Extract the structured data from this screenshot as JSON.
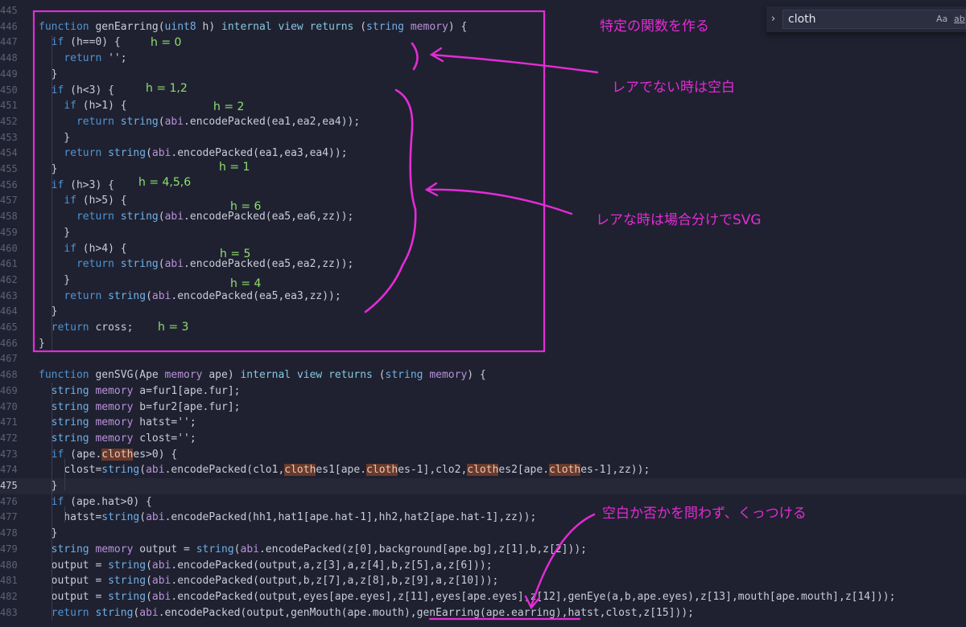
{
  "editor": {
    "lines": [
      {
        "n": "445",
        "code": []
      },
      {
        "n": "446",
        "code": [
          [
            "kw",
            "function"
          ],
          [
            "",
            ""
          ],
          [
            "",
            " genEarring("
          ],
          [
            "ty",
            "uint8"
          ],
          [
            "",
            " h) "
          ],
          [
            "mod",
            "internal"
          ],
          [
            "",
            " "
          ],
          [
            "mod",
            "view"
          ],
          [
            "",
            " "
          ],
          [
            "mod",
            "returns"
          ],
          [
            "",
            " ("
          ],
          [
            "ty",
            "string"
          ],
          [
            "",
            " "
          ],
          [
            "mem",
            "memory"
          ],
          [
            "",
            ") {"
          ]
        ]
      },
      {
        "n": "447",
        "code": [
          [
            "",
            "  "
          ],
          [
            "kw",
            "if"
          ],
          [
            "",
            " (h==0) {"
          ]
        ]
      },
      {
        "n": "448",
        "code": [
          [
            "",
            "    "
          ],
          [
            "kw",
            "return"
          ],
          [
            "",
            " '';"
          ]
        ]
      },
      {
        "n": "449",
        "code": [
          [
            "",
            "  }"
          ]
        ]
      },
      {
        "n": "450",
        "code": [
          [
            "",
            "  "
          ],
          [
            "kw",
            "if"
          ],
          [
            "",
            " (h<3) {"
          ]
        ]
      },
      {
        "n": "451",
        "code": [
          [
            "",
            "    "
          ],
          [
            "kw",
            "if"
          ],
          [
            "",
            " (h>1) {"
          ]
        ]
      },
      {
        "n": "452",
        "code": [
          [
            "",
            "      "
          ],
          [
            "kw",
            "return"
          ],
          [
            "",
            " "
          ],
          [
            "ty",
            "string"
          ],
          [
            "",
            "("
          ],
          [
            "mem",
            "abi"
          ],
          [
            "",
            ".encodePacked(ea1,ea2,ea4));"
          ]
        ]
      },
      {
        "n": "453",
        "code": [
          [
            "",
            "    }"
          ]
        ]
      },
      {
        "n": "454",
        "code": [
          [
            "",
            "    "
          ],
          [
            "kw",
            "return"
          ],
          [
            "",
            " "
          ],
          [
            "ty",
            "string"
          ],
          [
            "",
            "("
          ],
          [
            "mem",
            "abi"
          ],
          [
            "",
            ".encodePacked(ea1,ea3,ea4));"
          ]
        ]
      },
      {
        "n": "455",
        "code": [
          [
            "",
            "  }"
          ]
        ]
      },
      {
        "n": "456",
        "code": [
          [
            "",
            "  "
          ],
          [
            "kw",
            "if"
          ],
          [
            "",
            " (h>3) {"
          ]
        ]
      },
      {
        "n": "457",
        "code": [
          [
            "",
            "    "
          ],
          [
            "kw",
            "if"
          ],
          [
            "",
            " (h>5) {"
          ]
        ]
      },
      {
        "n": "458",
        "code": [
          [
            "",
            "      "
          ],
          [
            "kw",
            "return"
          ],
          [
            "",
            " "
          ],
          [
            "ty",
            "string"
          ],
          [
            "",
            "("
          ],
          [
            "mem",
            "abi"
          ],
          [
            "",
            ".encodePacked(ea5,ea6,zz));"
          ]
        ]
      },
      {
        "n": "459",
        "code": [
          [
            "",
            "    }"
          ]
        ]
      },
      {
        "n": "460",
        "code": [
          [
            "",
            "    "
          ],
          [
            "kw",
            "if"
          ],
          [
            "",
            " (h>4) {"
          ]
        ]
      },
      {
        "n": "461",
        "code": [
          [
            "",
            "      "
          ],
          [
            "kw",
            "return"
          ],
          [
            "",
            " "
          ],
          [
            "ty",
            "string"
          ],
          [
            "",
            "("
          ],
          [
            "mem",
            "abi"
          ],
          [
            "",
            ".encodePacked(ea5,ea2,zz));"
          ]
        ]
      },
      {
        "n": "462",
        "code": [
          [
            "",
            "    }"
          ]
        ]
      },
      {
        "n": "463",
        "code": [
          [
            "",
            "    "
          ],
          [
            "kw",
            "return"
          ],
          [
            "",
            " "
          ],
          [
            "ty",
            "string"
          ],
          [
            "",
            "("
          ],
          [
            "mem",
            "abi"
          ],
          [
            "",
            ".encodePacked(ea5,ea3,zz));"
          ]
        ]
      },
      {
        "n": "464",
        "code": [
          [
            "",
            "  }"
          ]
        ]
      },
      {
        "n": "465",
        "code": [
          [
            "",
            "  "
          ],
          [
            "kw",
            "return"
          ],
          [
            "",
            " cross;"
          ]
        ]
      },
      {
        "n": "466",
        "code": [
          [
            "",
            "}"
          ]
        ]
      },
      {
        "n": "467",
        "code": []
      },
      {
        "n": "468",
        "code": [
          [
            "kw",
            "function"
          ],
          [
            "",
            " genSVG(Ape "
          ],
          [
            "mem",
            "memory"
          ],
          [
            "",
            " ape) "
          ],
          [
            "mod",
            "internal"
          ],
          [
            "",
            " "
          ],
          [
            "mod",
            "view"
          ],
          [
            "",
            " "
          ],
          [
            "mod",
            "returns"
          ],
          [
            "",
            " ("
          ],
          [
            "ty",
            "string"
          ],
          [
            "",
            " "
          ],
          [
            "mem",
            "memory"
          ],
          [
            "",
            ") {"
          ]
        ]
      },
      {
        "n": "469",
        "code": [
          [
            "",
            "  "
          ],
          [
            "ty",
            "string"
          ],
          [
            "",
            " "
          ],
          [
            "mem",
            "memory"
          ],
          [
            "",
            " a=fur1[ape.fur];"
          ]
        ]
      },
      {
        "n": "470",
        "code": [
          [
            "",
            "  "
          ],
          [
            "ty",
            "string"
          ],
          [
            "",
            " "
          ],
          [
            "mem",
            "memory"
          ],
          [
            "",
            " b=fur2[ape.fur];"
          ]
        ]
      },
      {
        "n": "471",
        "code": [
          [
            "",
            "  "
          ],
          [
            "ty",
            "string"
          ],
          [
            "",
            " "
          ],
          [
            "mem",
            "memory"
          ],
          [
            "",
            " hatst='';"
          ]
        ]
      },
      {
        "n": "472",
        "code": [
          [
            "",
            "  "
          ],
          [
            "ty",
            "string"
          ],
          [
            "",
            " "
          ],
          [
            "mem",
            "memory"
          ],
          [
            "",
            " clost='';"
          ]
        ]
      },
      {
        "n": "473",
        "code": [
          [
            "",
            "  "
          ],
          [
            "kw",
            "if"
          ],
          [
            "",
            " (ape."
          ],
          [
            "hl",
            "cloth"
          ],
          [
            "",
            "es>0) {"
          ]
        ]
      },
      {
        "n": "474",
        "code": [
          [
            "",
            "    clost="
          ],
          [
            "ty",
            "string"
          ],
          [
            "",
            "("
          ],
          [
            "mem",
            "abi"
          ],
          [
            "",
            ".encodePacked(clo1,"
          ],
          [
            "hl",
            "cloth"
          ],
          [
            "",
            "es1[ape."
          ],
          [
            "hl",
            "cloth"
          ],
          [
            "",
            "es-1],clo2,"
          ],
          [
            "hl",
            "cloth"
          ],
          [
            "",
            "es2[ape."
          ],
          [
            "hl",
            "cloth"
          ],
          [
            "",
            "es-1],zz));"
          ]
        ]
      },
      {
        "n": "475",
        "code": [
          [
            "",
            "  }"
          ]
        ],
        "current": true
      },
      {
        "n": "476",
        "code": [
          [
            "",
            "  "
          ],
          [
            "kw",
            "if"
          ],
          [
            "",
            " (ape.hat>0) {"
          ]
        ]
      },
      {
        "n": "477",
        "code": [
          [
            "",
            "    hatst="
          ],
          [
            "ty",
            "string"
          ],
          [
            "",
            "("
          ],
          [
            "mem",
            "abi"
          ],
          [
            "",
            ".encodePacked(hh1,hat1[ape.hat-1],hh2,hat2[ape.hat-1],zz));"
          ]
        ]
      },
      {
        "n": "478",
        "code": [
          [
            "",
            "  }"
          ]
        ]
      },
      {
        "n": "479",
        "code": [
          [
            "",
            "  "
          ],
          [
            "ty",
            "string"
          ],
          [
            "",
            " "
          ],
          [
            "mem",
            "memory"
          ],
          [
            "",
            " output = "
          ],
          [
            "ty",
            "string"
          ],
          [
            "",
            "("
          ],
          [
            "mem",
            "abi"
          ],
          [
            "",
            ".encodePacked(z[0],background[ape.bg],z[1],b,z[2]));"
          ]
        ]
      },
      {
        "n": "480",
        "code": [
          [
            "",
            "  output = "
          ],
          [
            "ty",
            "string"
          ],
          [
            "",
            "("
          ],
          [
            "mem",
            "abi"
          ],
          [
            "",
            ".encodePacked(output,a,z[3],a,z[4],b,z[5],a,z[6]));"
          ]
        ]
      },
      {
        "n": "481",
        "code": [
          [
            "",
            "  output = "
          ],
          [
            "ty",
            "string"
          ],
          [
            "",
            "("
          ],
          [
            "mem",
            "abi"
          ],
          [
            "",
            ".encodePacked(output,b,z[7],a,z[8],b,z[9],a,z[10]));"
          ]
        ]
      },
      {
        "n": "482",
        "code": [
          [
            "",
            "  output = "
          ],
          [
            "ty",
            "string"
          ],
          [
            "",
            "("
          ],
          [
            "mem",
            "abi"
          ],
          [
            "",
            ".encodePacked(output,eyes[ape.eyes],z[11],eyes[ape.eyes],z[12],genEye(a,b,ape.eyes),z[13],mouth[ape.mouth],z[14]));"
          ]
        ]
      },
      {
        "n": "483",
        "code": [
          [
            "",
            "  "
          ],
          [
            "kw",
            "return"
          ],
          [
            "",
            " "
          ],
          [
            "ty",
            "string"
          ],
          [
            "",
            "("
          ],
          [
            "mem",
            "abi"
          ],
          [
            "",
            ".encodePacked(output,genMouth(ape.mouth),genEarring(ape.earring),hatst,clost,z[15]));"
          ]
        ]
      }
    ]
  },
  "find": {
    "toggle_icon": "chevron-right-icon",
    "query": "cloth",
    "match_case_label": "Aa",
    "whole_word_label": "ab"
  },
  "annotations": {
    "title_note": "特定の関数を作る",
    "blank_note": "レアでない時は空白",
    "rare_note": "レアな時は場合分けでSVG",
    "concat_note": "空白か否かを問わず、くっつける",
    "h_labels": {
      "h0": "h = 0",
      "h12": "h = 1,2",
      "h2": "h = 2",
      "h1": "h = 1",
      "h456": "h = 4,5,6",
      "h6": "h = 6",
      "h5": "h = 5",
      "h4": "h = 4",
      "h3": "h = 3"
    },
    "ink_color": "#e52bd6"
  }
}
